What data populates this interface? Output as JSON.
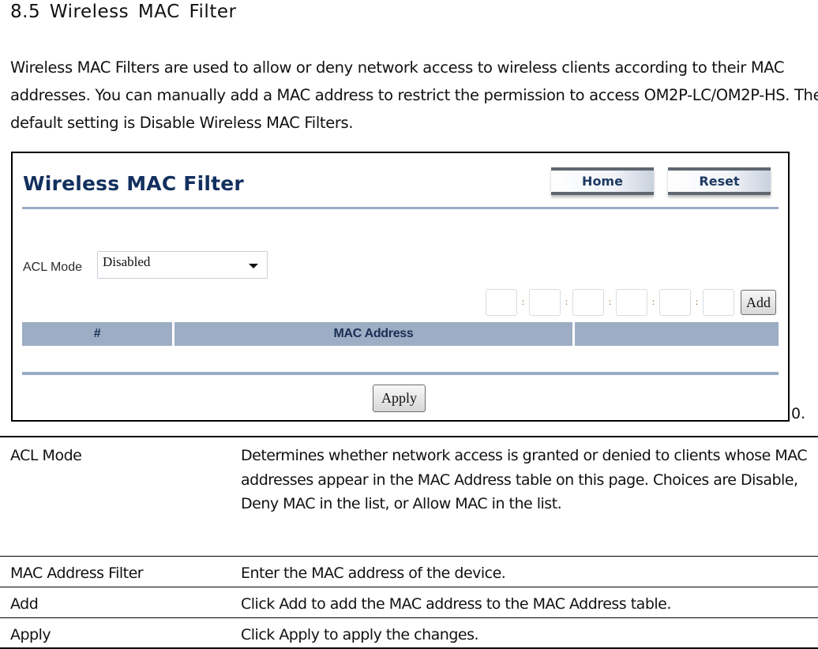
{
  "document": {
    "heading": "8.5 Wireless  MAC  Filter",
    "intro": "Wireless MAC Filters are used to allow or deny network access to wireless clients according to their MAC addresses. You can manually add a MAC address to restrict the permission to access OM2P-LC/OM2P-HS. The default setting is Disable Wireless MAC Filters.",
    "figure_suffix": "0."
  },
  "ui": {
    "title": "Wireless MAC Filter",
    "buttons": {
      "home": "Home",
      "reset": "Reset",
      "add": "Add",
      "apply": "Apply"
    },
    "acl_mode": {
      "label": "ACL Mode",
      "selected": "Disabled"
    },
    "mac_input": {
      "octets": [
        "",
        "",
        "",
        "",
        "",
        ""
      ],
      "separator": ":"
    },
    "table": {
      "columns": [
        "#",
        "MAC Address",
        ""
      ],
      "rows": []
    }
  },
  "descriptions": [
    {
      "term": "ACL Mode",
      "text": "Determines whether network access is granted or denied to clients whose MAC addresses appear in the MAC Address table on this page. Choices are Disable, Deny MAC in the list, or Allow MAC in the list."
    },
    {
      "term": "MAC Address  Filter",
      "text": "Enter the MAC address of the device."
    },
    {
      "term": "Add",
      "text": "Click Add  to add the MAC address to the MAC Address  table."
    },
    {
      "term": "Apply",
      "text": "Click Apply  to apply the changes."
    }
  ]
}
